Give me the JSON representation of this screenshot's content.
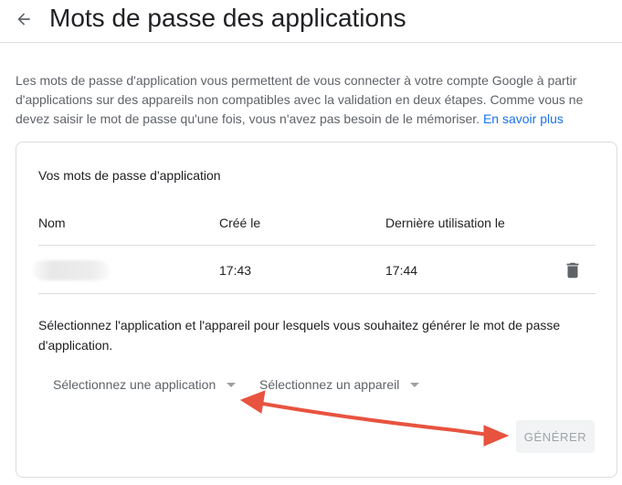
{
  "header": {
    "title": "Mots de passe des applications",
    "back_icon": "arrow-back-icon"
  },
  "intro": {
    "text": "Les mots de passe d'application vous permettent de vous connecter à votre compte Google à partir d'applications sur des appareils non compatibles avec la validation en deux étapes. Comme vous ne devez saisir le mot de passe qu'une fois, vous n'avez pas besoin de le mémoriser.",
    "link": "En savoir plus",
    "link_color": "#1a73e8"
  },
  "card": {
    "title": "Vos mots de passe d'application",
    "columns": {
      "name": "Nom",
      "created": "Créé le",
      "last_used": "Dernière utilisation le"
    },
    "rows": [
      {
        "name": "",
        "created": "17:43",
        "last_used": "17:44",
        "action_icon": "trash-icon"
      }
    ],
    "select_description": "Sélectionnez l'application et l'appareil pour lesquels vous souhaitez générer le mot de passe d'application.",
    "app_select": {
      "value": "Sélectionnez une application"
    },
    "device_select": {
      "value": "Sélectionnez un appareil"
    },
    "generate_label": "GÉNÉRER"
  },
  "annotation": {
    "color": "#e8533f",
    "kind": "double-headed-arrow"
  }
}
